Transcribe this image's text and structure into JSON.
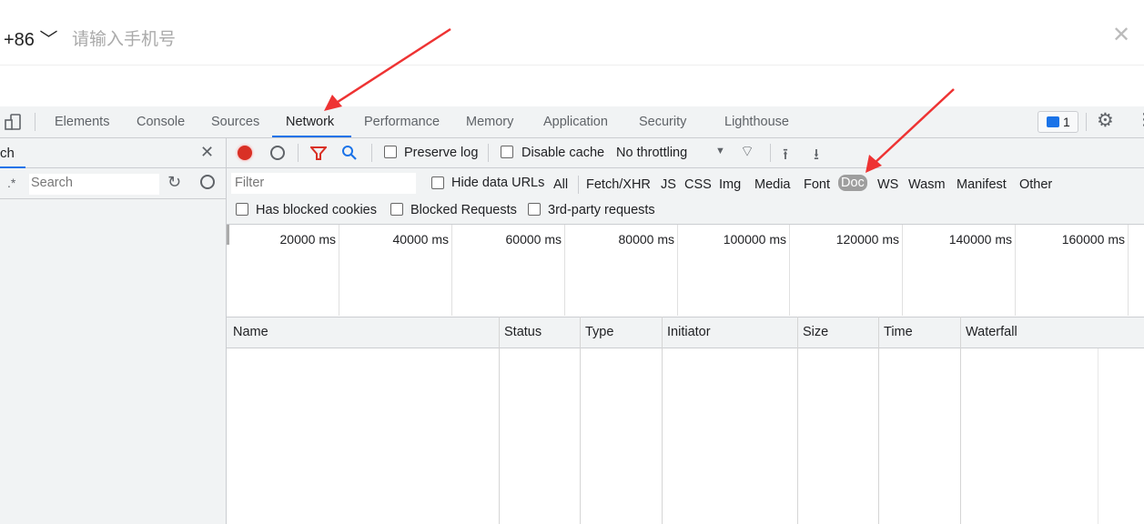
{
  "page": {
    "country_code": "+86",
    "chevron": "﹀",
    "phone_placeholder": "请输入手机号",
    "close": "✕"
  },
  "devtools": {
    "tabs": [
      "Elements",
      "Console",
      "Sources",
      "Network",
      "Performance",
      "Memory",
      "Application",
      "Security",
      "Lighthouse"
    ],
    "active_tab": "Network",
    "messages_count": "1",
    "search_panel": {
      "title": "ch",
      "regex": ".*",
      "search_placeholder": "Search"
    },
    "toolbar": {
      "preserve_log": "Preserve log",
      "disable_cache": "Disable cache",
      "throttling": "No throttling"
    },
    "filter": {
      "placeholder": "Filter",
      "hide_data_urls": "Hide data URLs",
      "types": [
        "All",
        "Fetch/XHR",
        "JS",
        "CSS",
        "Img",
        "Media",
        "Font",
        "Doc",
        "WS",
        "Wasm",
        "Manifest",
        "Other"
      ],
      "selected_type": "Doc"
    },
    "checkboxes": [
      "Has blocked cookies",
      "Blocked Requests",
      "3rd-party requests"
    ],
    "timeline_ticks": [
      "20000 ms",
      "40000 ms",
      "60000 ms",
      "80000 ms",
      "100000 ms",
      "120000 ms",
      "140000 ms",
      "160000 ms"
    ],
    "columns": [
      "Name",
      "Status",
      "Type",
      "Initiator",
      "Size",
      "Time",
      "Waterfall"
    ],
    "annotation_color": "#ee3333"
  }
}
